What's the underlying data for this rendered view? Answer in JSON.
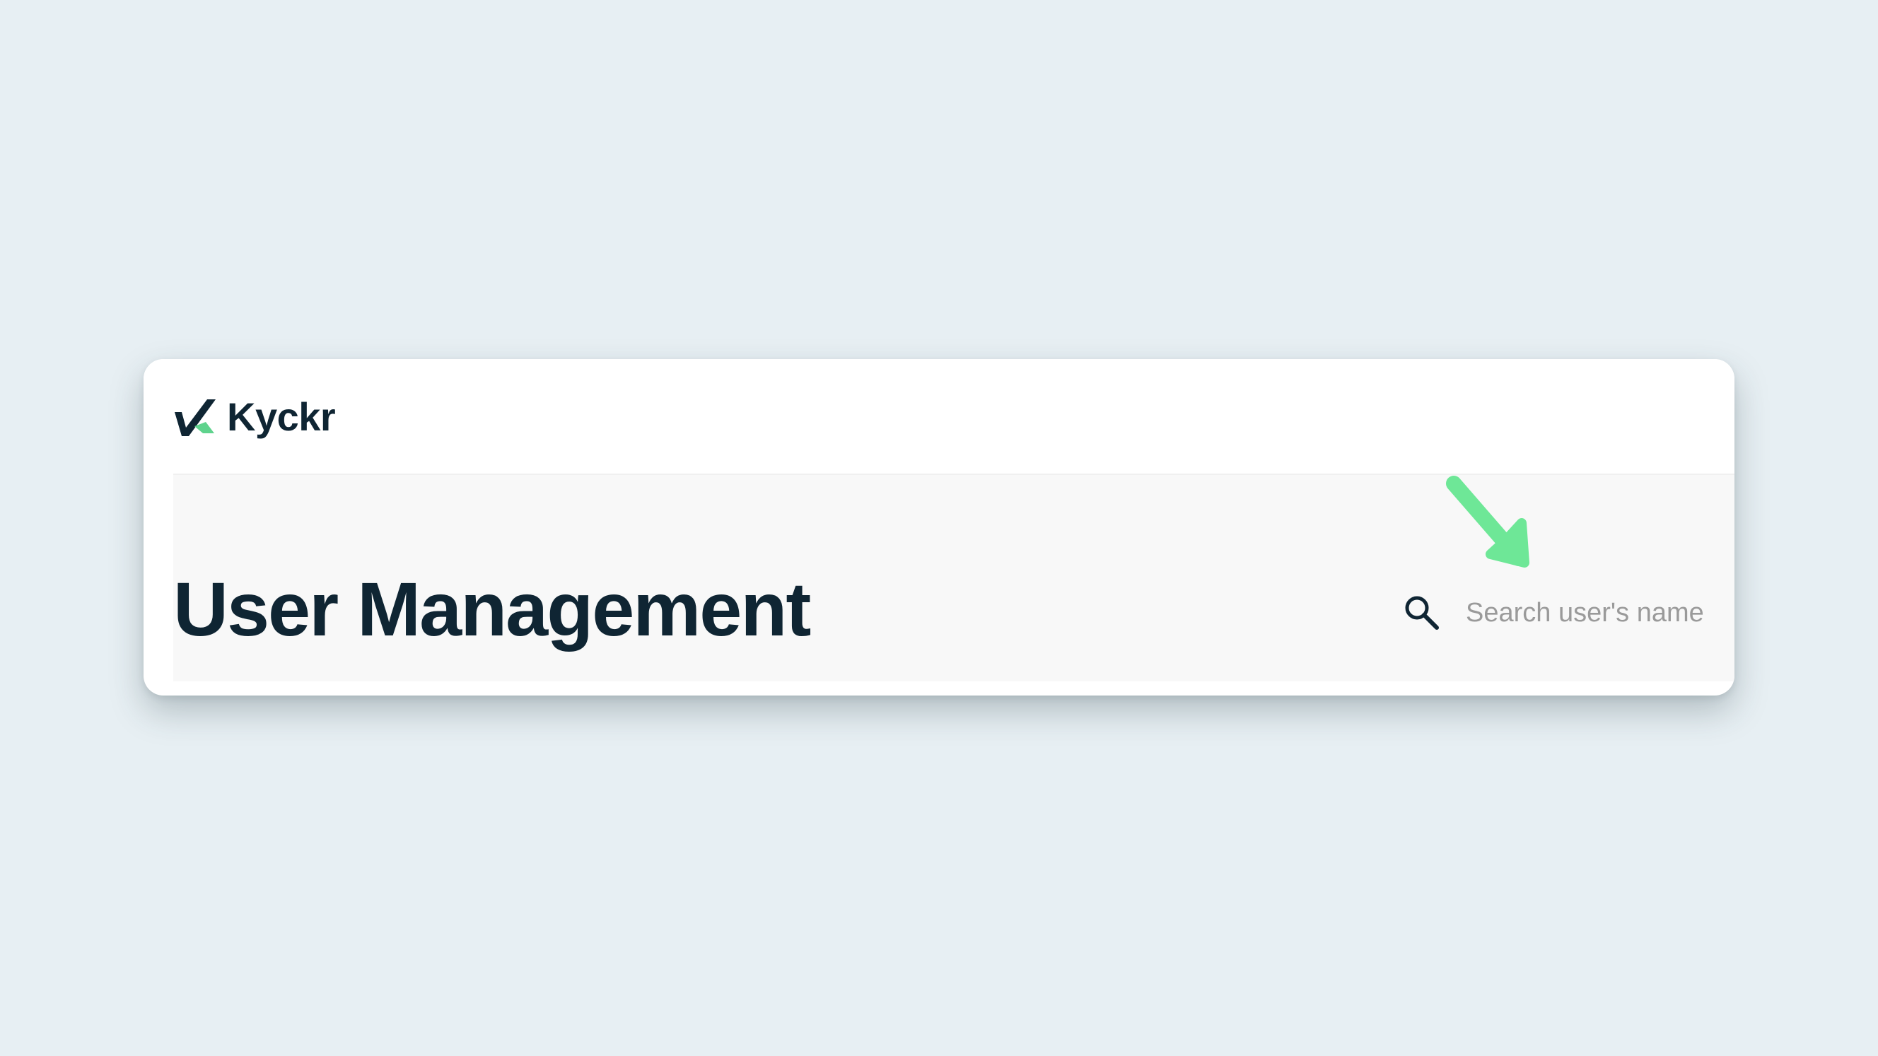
{
  "app": {
    "brand_name": "Kyckr",
    "logo_colors": {
      "dark": "#0f2533",
      "accent": "#5fd38d"
    }
  },
  "page": {
    "title": "User Management"
  },
  "search": {
    "icon": "search-icon",
    "placeholder": "Search user's name",
    "value": ""
  },
  "annotation": {
    "icon": "arrow-down-right-icon",
    "color": "#6ee797"
  }
}
